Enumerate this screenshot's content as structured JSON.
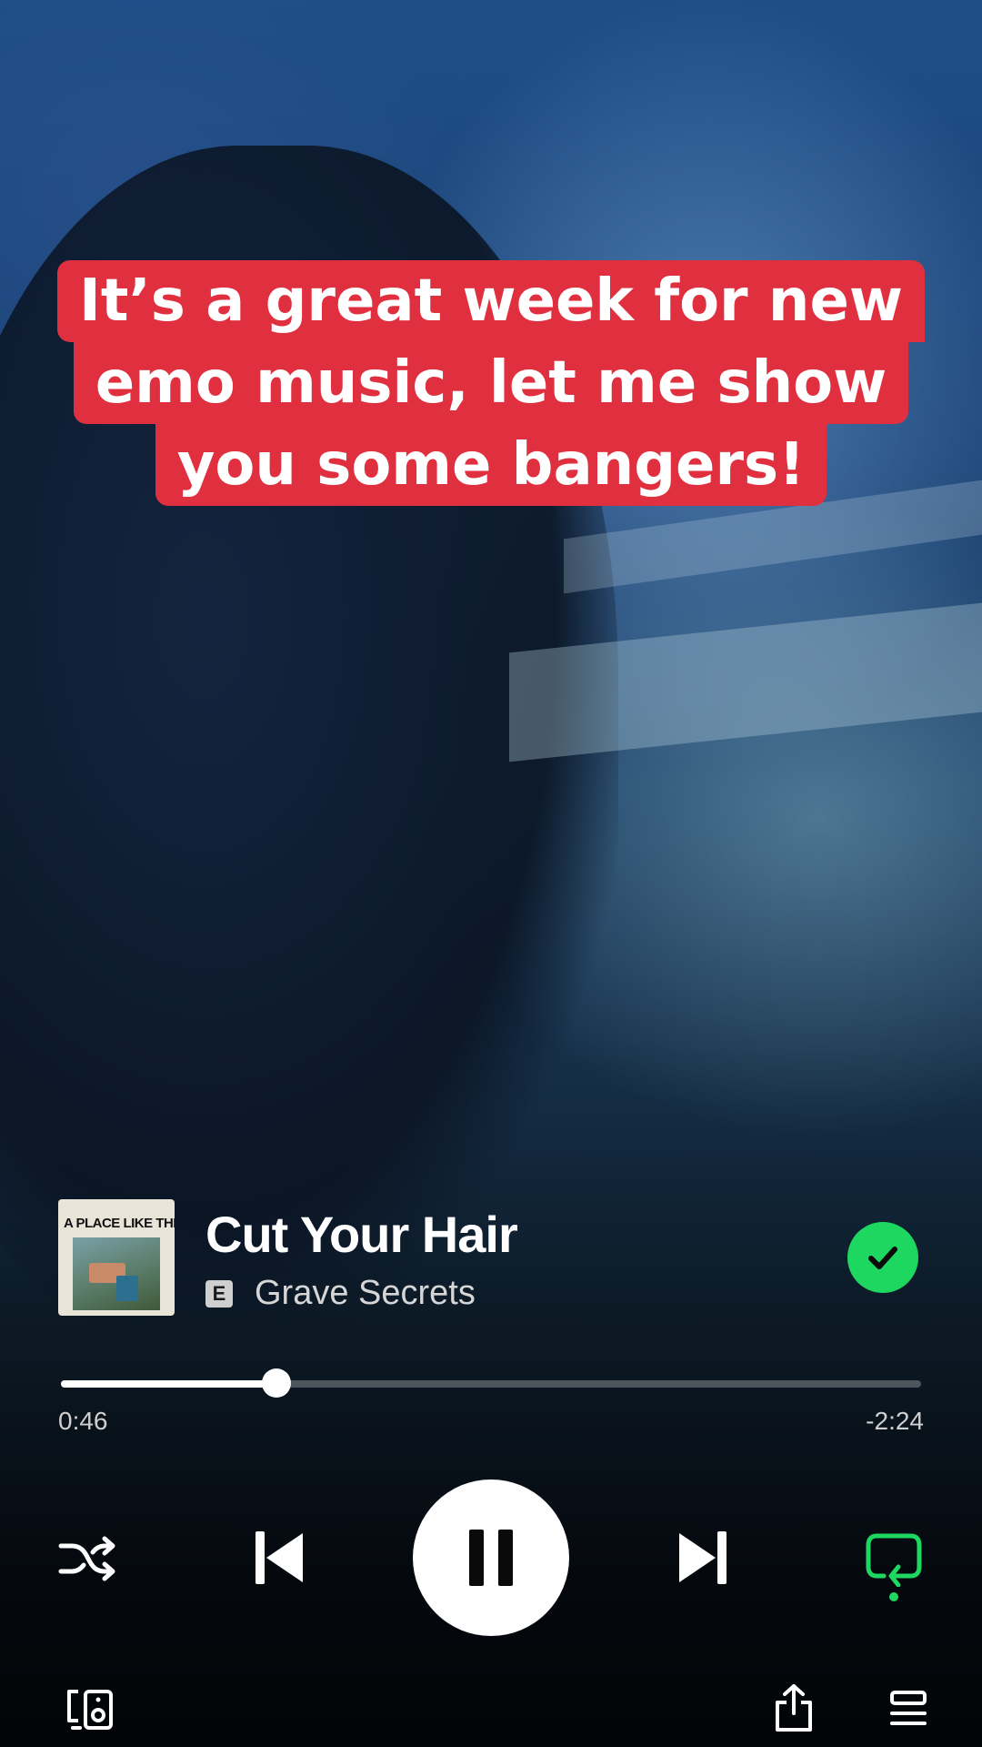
{
  "caption": {
    "line1": "It’s a great week for new",
    "line2": "emo music, let me show",
    "line3": "you some bangers!"
  },
  "track": {
    "title": "Cut Your Hair",
    "artist": "Grave Secrets",
    "explicit_label": "E",
    "album_art_text": "A PLACE LIKE THIS",
    "saved": true
  },
  "playback": {
    "elapsed": "0:46",
    "remaining": "-2:24",
    "progress_fraction": 0.25,
    "state": "playing",
    "repeat": "on",
    "shuffle": "off"
  },
  "icons": {
    "shuffle": "shuffle-icon",
    "previous": "skip-previous-icon",
    "pause": "pause-icon",
    "next": "skip-next-icon",
    "repeat": "repeat-icon",
    "devices": "connect-device-icon",
    "share": "share-icon",
    "queue": "queue-icon",
    "saved": "checkmark-icon"
  },
  "colors": {
    "caption_bg": "#e0303f",
    "accent": "#1ed760"
  }
}
